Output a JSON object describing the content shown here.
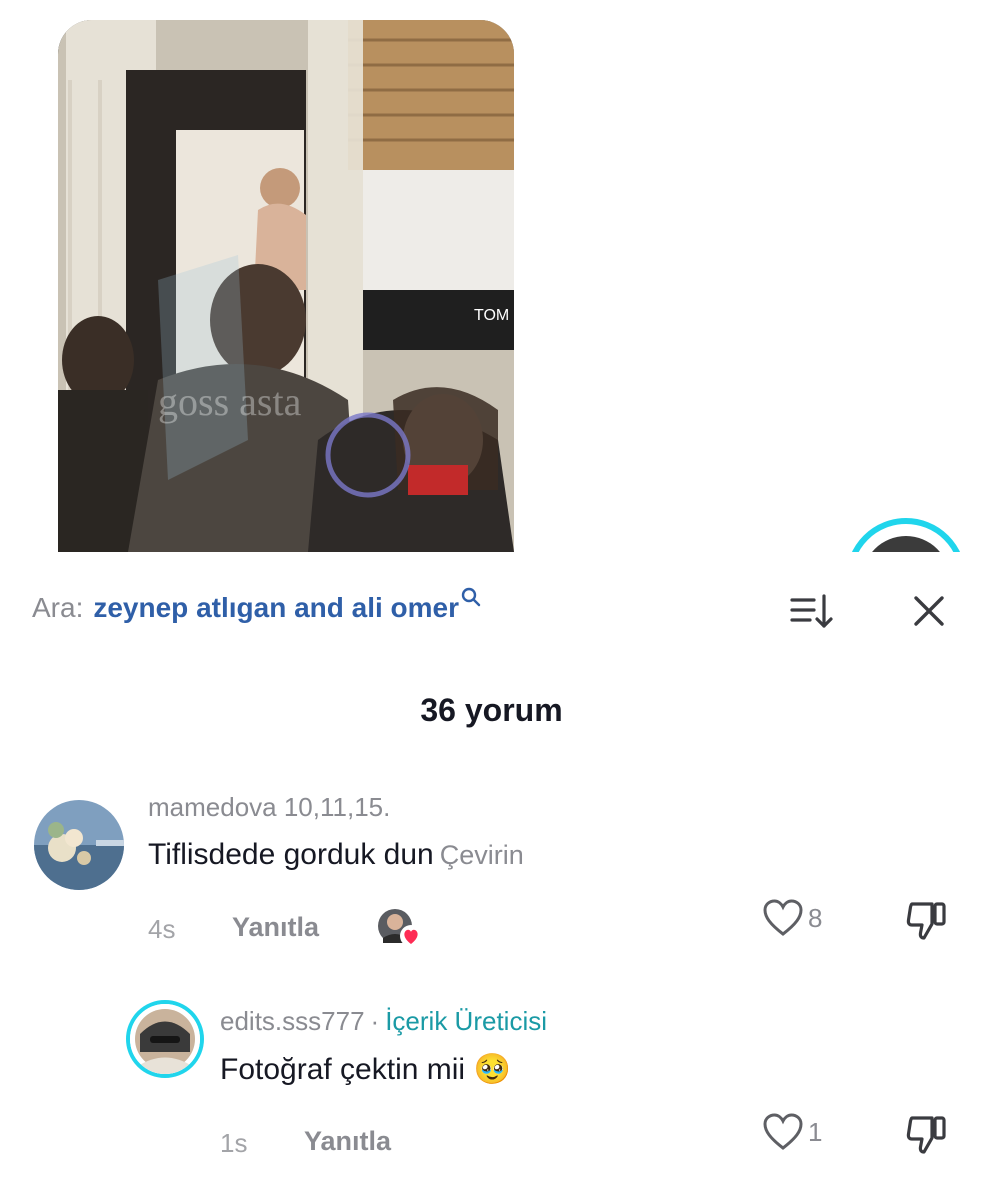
{
  "search": {
    "prefix": "Ara:",
    "query": "zeynep atlıgan and ali omer"
  },
  "comments_header": {
    "count_label": "36 yorum"
  },
  "comments": [
    {
      "username": "mamedova 10,11,15.",
      "text": "Tiflisdede gorduk dun",
      "translate_label": "Çevirin",
      "time": "4s",
      "reply_label": "Yanıtla",
      "likes": "8"
    }
  ],
  "reply": {
    "username": "edits.sss777",
    "separator": "·",
    "badge": "İçerik Üreticisi",
    "text": "Fotoğraf çektin mii",
    "emoji": "🥹",
    "time": "1s",
    "reply_label": "Yanıtla",
    "likes": "1"
  },
  "colors": {
    "accent_teal": "#1a9aa5",
    "search_blue": "#2f5fa8",
    "muted_gray": "#8a8b91",
    "ring_cyan": "#20d5ec",
    "heart_red": "#fe2c55"
  },
  "icons": [
    "search-icon",
    "sort-icon",
    "close-icon",
    "heart-icon",
    "dislike-icon",
    "creator-heart-badge-icon"
  ]
}
